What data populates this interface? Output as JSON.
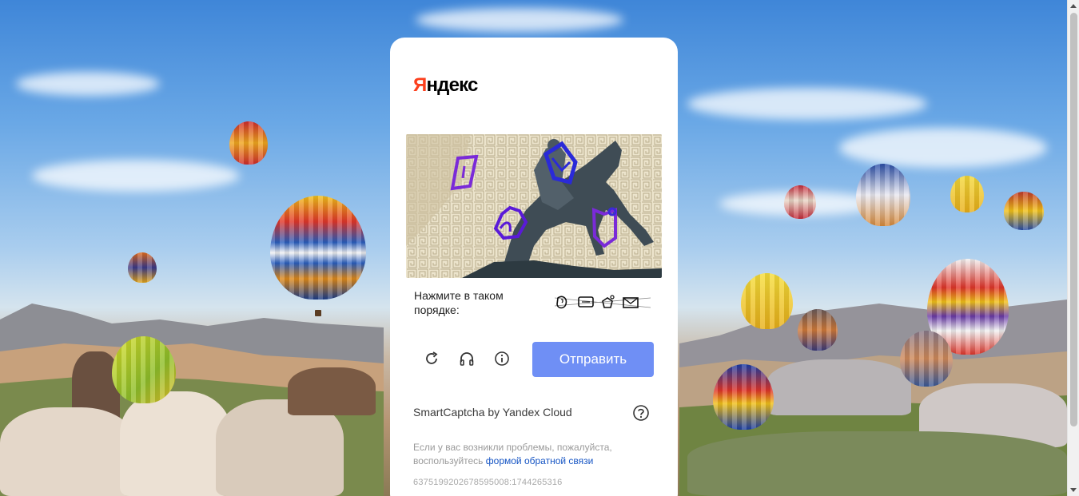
{
  "brand_logo": {
    "first_letter": "Я",
    "rest": "ндекс",
    "accent_color": "#fc3f1d"
  },
  "captcha": {
    "image_description_icons": [
      "paper-icon",
      "envelope-icon",
      "pear-icon",
      "letter-i-icon"
    ],
    "instruction": "Нажмите в таком порядке:",
    "order_icons": [
      "pear-icon",
      "paper-icon",
      "letter-i-icon",
      "envelope-icon"
    ]
  },
  "controls": {
    "refresh_icon": "refresh-icon",
    "audio_icon": "headphones-icon",
    "info_icon": "info-icon",
    "submit_label": "Отправить",
    "submit_color": "#6f8ff5"
  },
  "footer": {
    "brand_text": "SmartCaptcha by Yandex Cloud",
    "help_icon": "question-icon",
    "note_prefix": "Если у вас возникли проблемы, пожалуйста, воспользуйтесь",
    "note_link": "формой обратной связи",
    "ray_id": "63751992026785950​08:1744265316"
  }
}
